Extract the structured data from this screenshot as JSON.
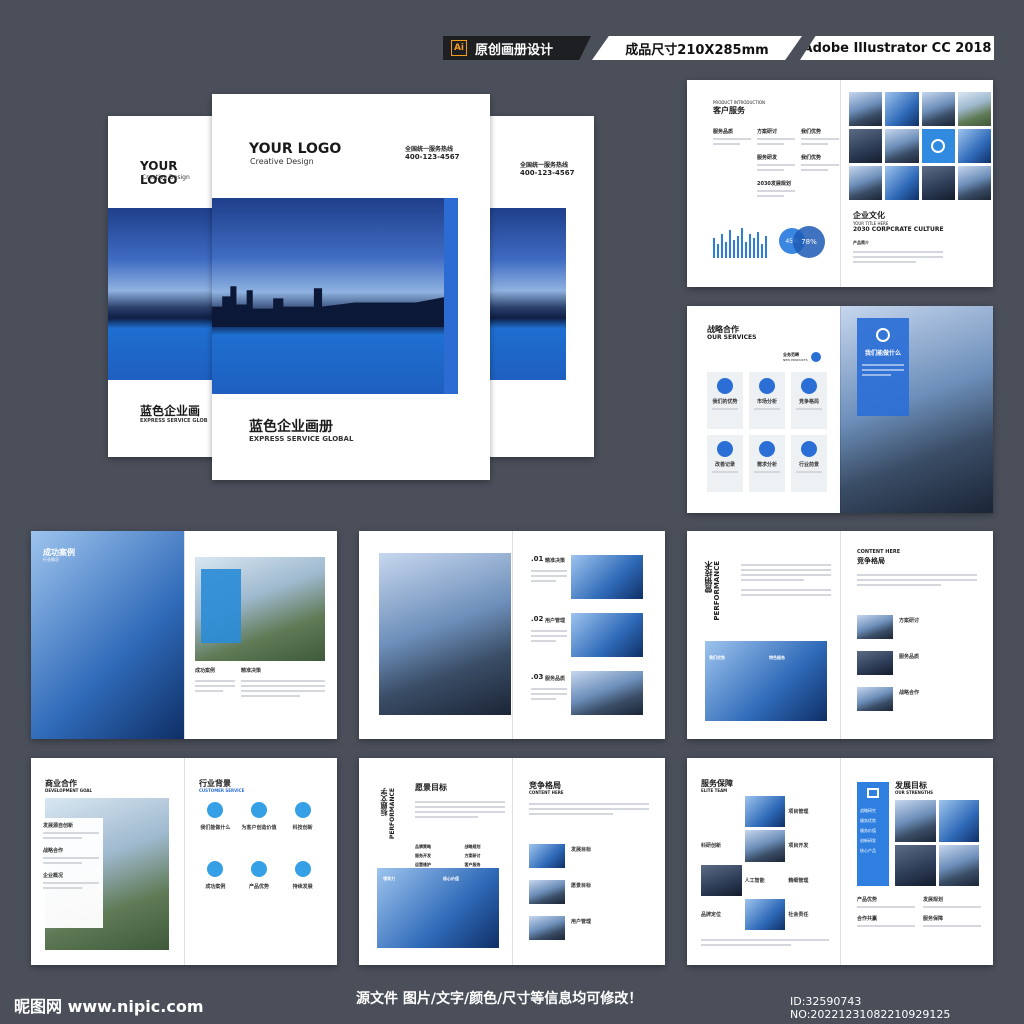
{
  "header": {
    "ai_badge": "Ai",
    "label1": "原创画册设计",
    "label2": "成品尺寸210X285mm",
    "label3": "Adobe Illustrator CC 2018"
  },
  "cover": {
    "logo": "YOUR LOGO",
    "logo_sub": "Creative Design",
    "hotline_label": "全国统一服务热线",
    "hotline": "400-123-4567",
    "title": "蓝色企业画册",
    "subtitle": "EXPRESS SERVICE GLOBAL",
    "left_title": "蓝色企业画",
    "left_subtitle": "EXPRESS SERVICE GLOB"
  },
  "spread1": {
    "kicker": "PRODUCT INTRODUCTION",
    "title": "客户服务",
    "items": [
      "服务品质",
      "方案研讨",
      "我们优势",
      "服务研发",
      "我们优势",
      "2030发展规划"
    ],
    "pct1": "45%",
    "pct2": "78%",
    "culture_title": "企业文化",
    "culture_sub": "YOUR TITLE HERE",
    "culture_en": "2030 CORPCRATE CULTURE",
    "culture_item": "产品简介"
  },
  "spread2": {
    "title": "战略合作",
    "title_en": "OUR SERVICES",
    "side_title": "业务范畴",
    "side_en": "NEW PRODUCTS",
    "cards": [
      "我们的优势",
      "市场分析",
      "竞争格局",
      "改善记录",
      "需求分析",
      "行业前景"
    ],
    "box_title": "我们能做什么"
  },
  "spread3": {
    "title": "成功案例",
    "title_en": "行业概况",
    "label1": "成功案例",
    "label2": "精准决策"
  },
  "spread4": {
    "items": [
      {
        "no": ".01",
        "label": "精准决策"
      },
      {
        "no": ".02",
        "label": "用户管理"
      },
      {
        "no": ".03",
        "label": "服务品质"
      }
    ]
  },
  "spread5": {
    "vertical_cn": "营销技术",
    "vertical_en": "PERFORMANCE",
    "heading_en": "CONTENT HERE",
    "heading_cn": "竞争格局",
    "boxes": [
      "我们优势",
      "特色服务"
    ],
    "items": [
      "方案研讨",
      "服务品质",
      "战略合作"
    ]
  },
  "spread6": {
    "title": "商业合作",
    "title_en": "DEVELOPMENT GOAL",
    "items": [
      "发展源自创新",
      "战略合作",
      "企业概况"
    ],
    "right_title": "行业背景",
    "right_en": "CUSTOMER SERVICE",
    "icons_row1": [
      "我们能做什么",
      "为客户创造价值",
      "科技创新"
    ],
    "icons_row2": [
      "成功案例",
      "产品优势",
      "持续发展"
    ]
  },
  "spread7": {
    "title": "愿景目标",
    "vertical_cn": "标题文字",
    "vertical_en": "PERFORMANCE",
    "checks": [
      "品牌策略",
      "战略规划",
      "服务开发",
      "方案研讨",
      "运营维护",
      "客户服务"
    ],
    "box_labels": [
      "领导力",
      "核心价值"
    ],
    "right_title": "竞争格局",
    "right_en": "CONTENT HERE",
    "items": [
      "发展目标",
      "愿景目标",
      "用户管理"
    ]
  },
  "spread8": {
    "title": "服务保障",
    "title_en": "ELITE TEAM",
    "labels": [
      "项目管理",
      "科研创新",
      "项目开发",
      "人工智能",
      "精细管理",
      "品牌定位",
      "社会责任"
    ],
    "right_title": "发展目标",
    "right_en": "OUR STRENGTHS",
    "list": [
      "战略研究",
      "服务优势",
      "服务价值",
      "创新研发",
      "核心产品"
    ],
    "bottom": [
      "产品优势",
      "发展规划",
      "合作共赢",
      "服务保障"
    ]
  },
  "footer": {
    "site_logo": "昵图网 www.nipic.com",
    "note": "源文件 图片/文字/颜色/尺寸等信息均可修改！",
    "id": "ID:32590743 NO:20221231082210929125"
  }
}
